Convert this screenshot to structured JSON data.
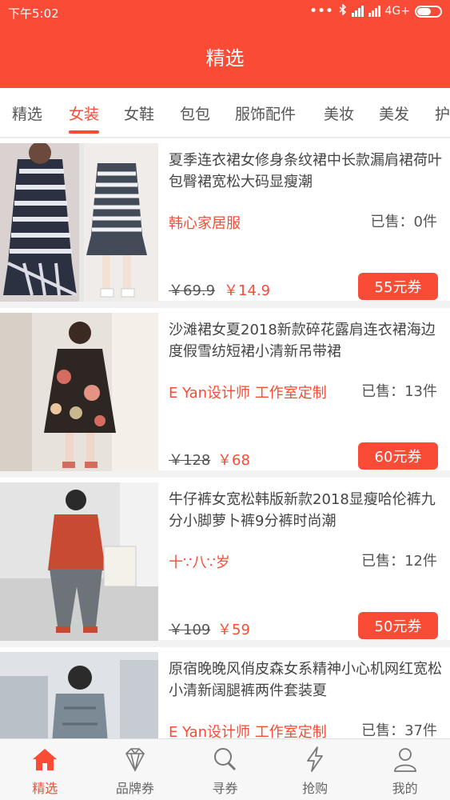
{
  "status": {
    "time": "下午5:02",
    "network": "4G+",
    "dots": "•••"
  },
  "header": {
    "title": "精选"
  },
  "tabs": [
    {
      "label": "精选"
    },
    {
      "label": "女装"
    },
    {
      "label": "女鞋"
    },
    {
      "label": "包包"
    },
    {
      "label": "服饰配件"
    },
    {
      "label": "美妆"
    },
    {
      "label": "美发"
    },
    {
      "label": "护"
    }
  ],
  "active_tab": "女装",
  "products": [
    {
      "title": "夏季连衣裙女修身条纹裙中长款漏肩裙荷叶包臀裙宽松大码显瘦潮",
      "shop": "韩心家居服",
      "sold": "已售：0件",
      "original_price": "￥69.9",
      "price": "￥14.9",
      "coupon": "55元券"
    },
    {
      "title": "沙滩裙女夏2018新款碎花露肩连衣裙海边度假雪纺短裙小清新吊带裙",
      "shop": "E Yan设计师 工作室定制",
      "sold": "已售：13件",
      "original_price": "￥128",
      "price": "￥68",
      "coupon": "60元券"
    },
    {
      "title": "牛仔裤女宽松韩版新款2018显瘦哈伦裤九分小脚萝卜裤9分裤时尚潮",
      "shop": "十∵八∵岁",
      "sold": "已售：12件",
      "original_price": "￥109",
      "price": "￥59",
      "coupon": "50元券"
    },
    {
      "title": "原宿晚晚风俏皮森女系精神小心机网红宽松小清新阔腿裤两件套装夏",
      "shop": "E Yan设计师 工作室定制",
      "sold": "已售：37件",
      "original_price": "",
      "price": "",
      "coupon": ""
    }
  ],
  "bottom_nav": [
    {
      "label": "精选",
      "icon": "home-icon"
    },
    {
      "label": "品牌券",
      "icon": "diamond-icon"
    },
    {
      "label": "寻券",
      "icon": "search-icon"
    },
    {
      "label": "抢购",
      "icon": "lightning-icon"
    },
    {
      "label": "我的",
      "icon": "user-icon"
    }
  ],
  "colors": {
    "accent": "#f94b35",
    "background": "#f2f2f2"
  }
}
